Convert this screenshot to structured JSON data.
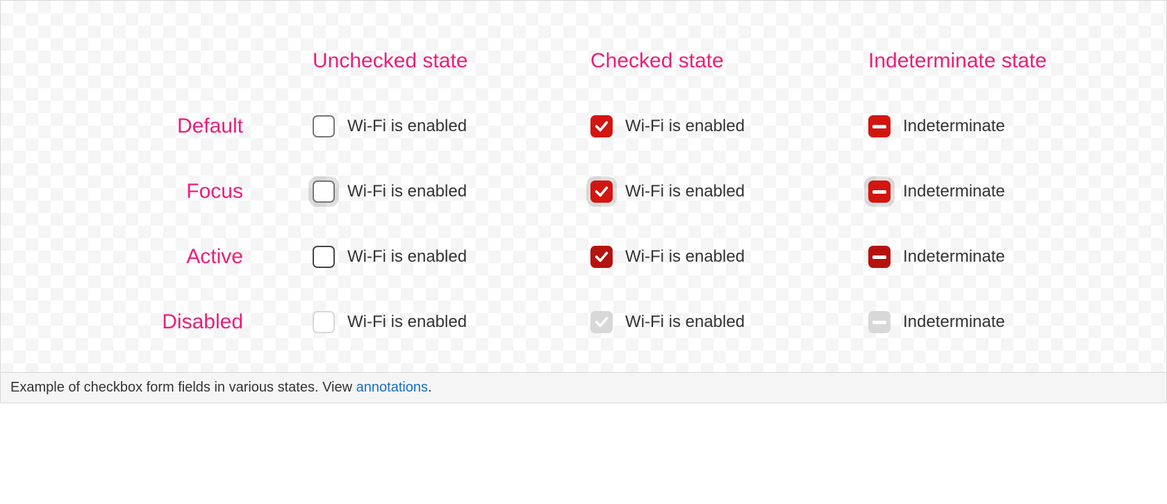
{
  "columns": [
    "Unchecked state",
    "Checked state",
    "Indeterminate state"
  ],
  "rows": [
    "Default",
    "Focus",
    "Active",
    "Disabled"
  ],
  "labels": {
    "wifi": "Wi-Fi is enabled",
    "indet": "Indeterminate"
  },
  "caption": {
    "prefix": "Example of checkbox form fields in various states. View ",
    "link": "annotations",
    "suffix": "."
  }
}
